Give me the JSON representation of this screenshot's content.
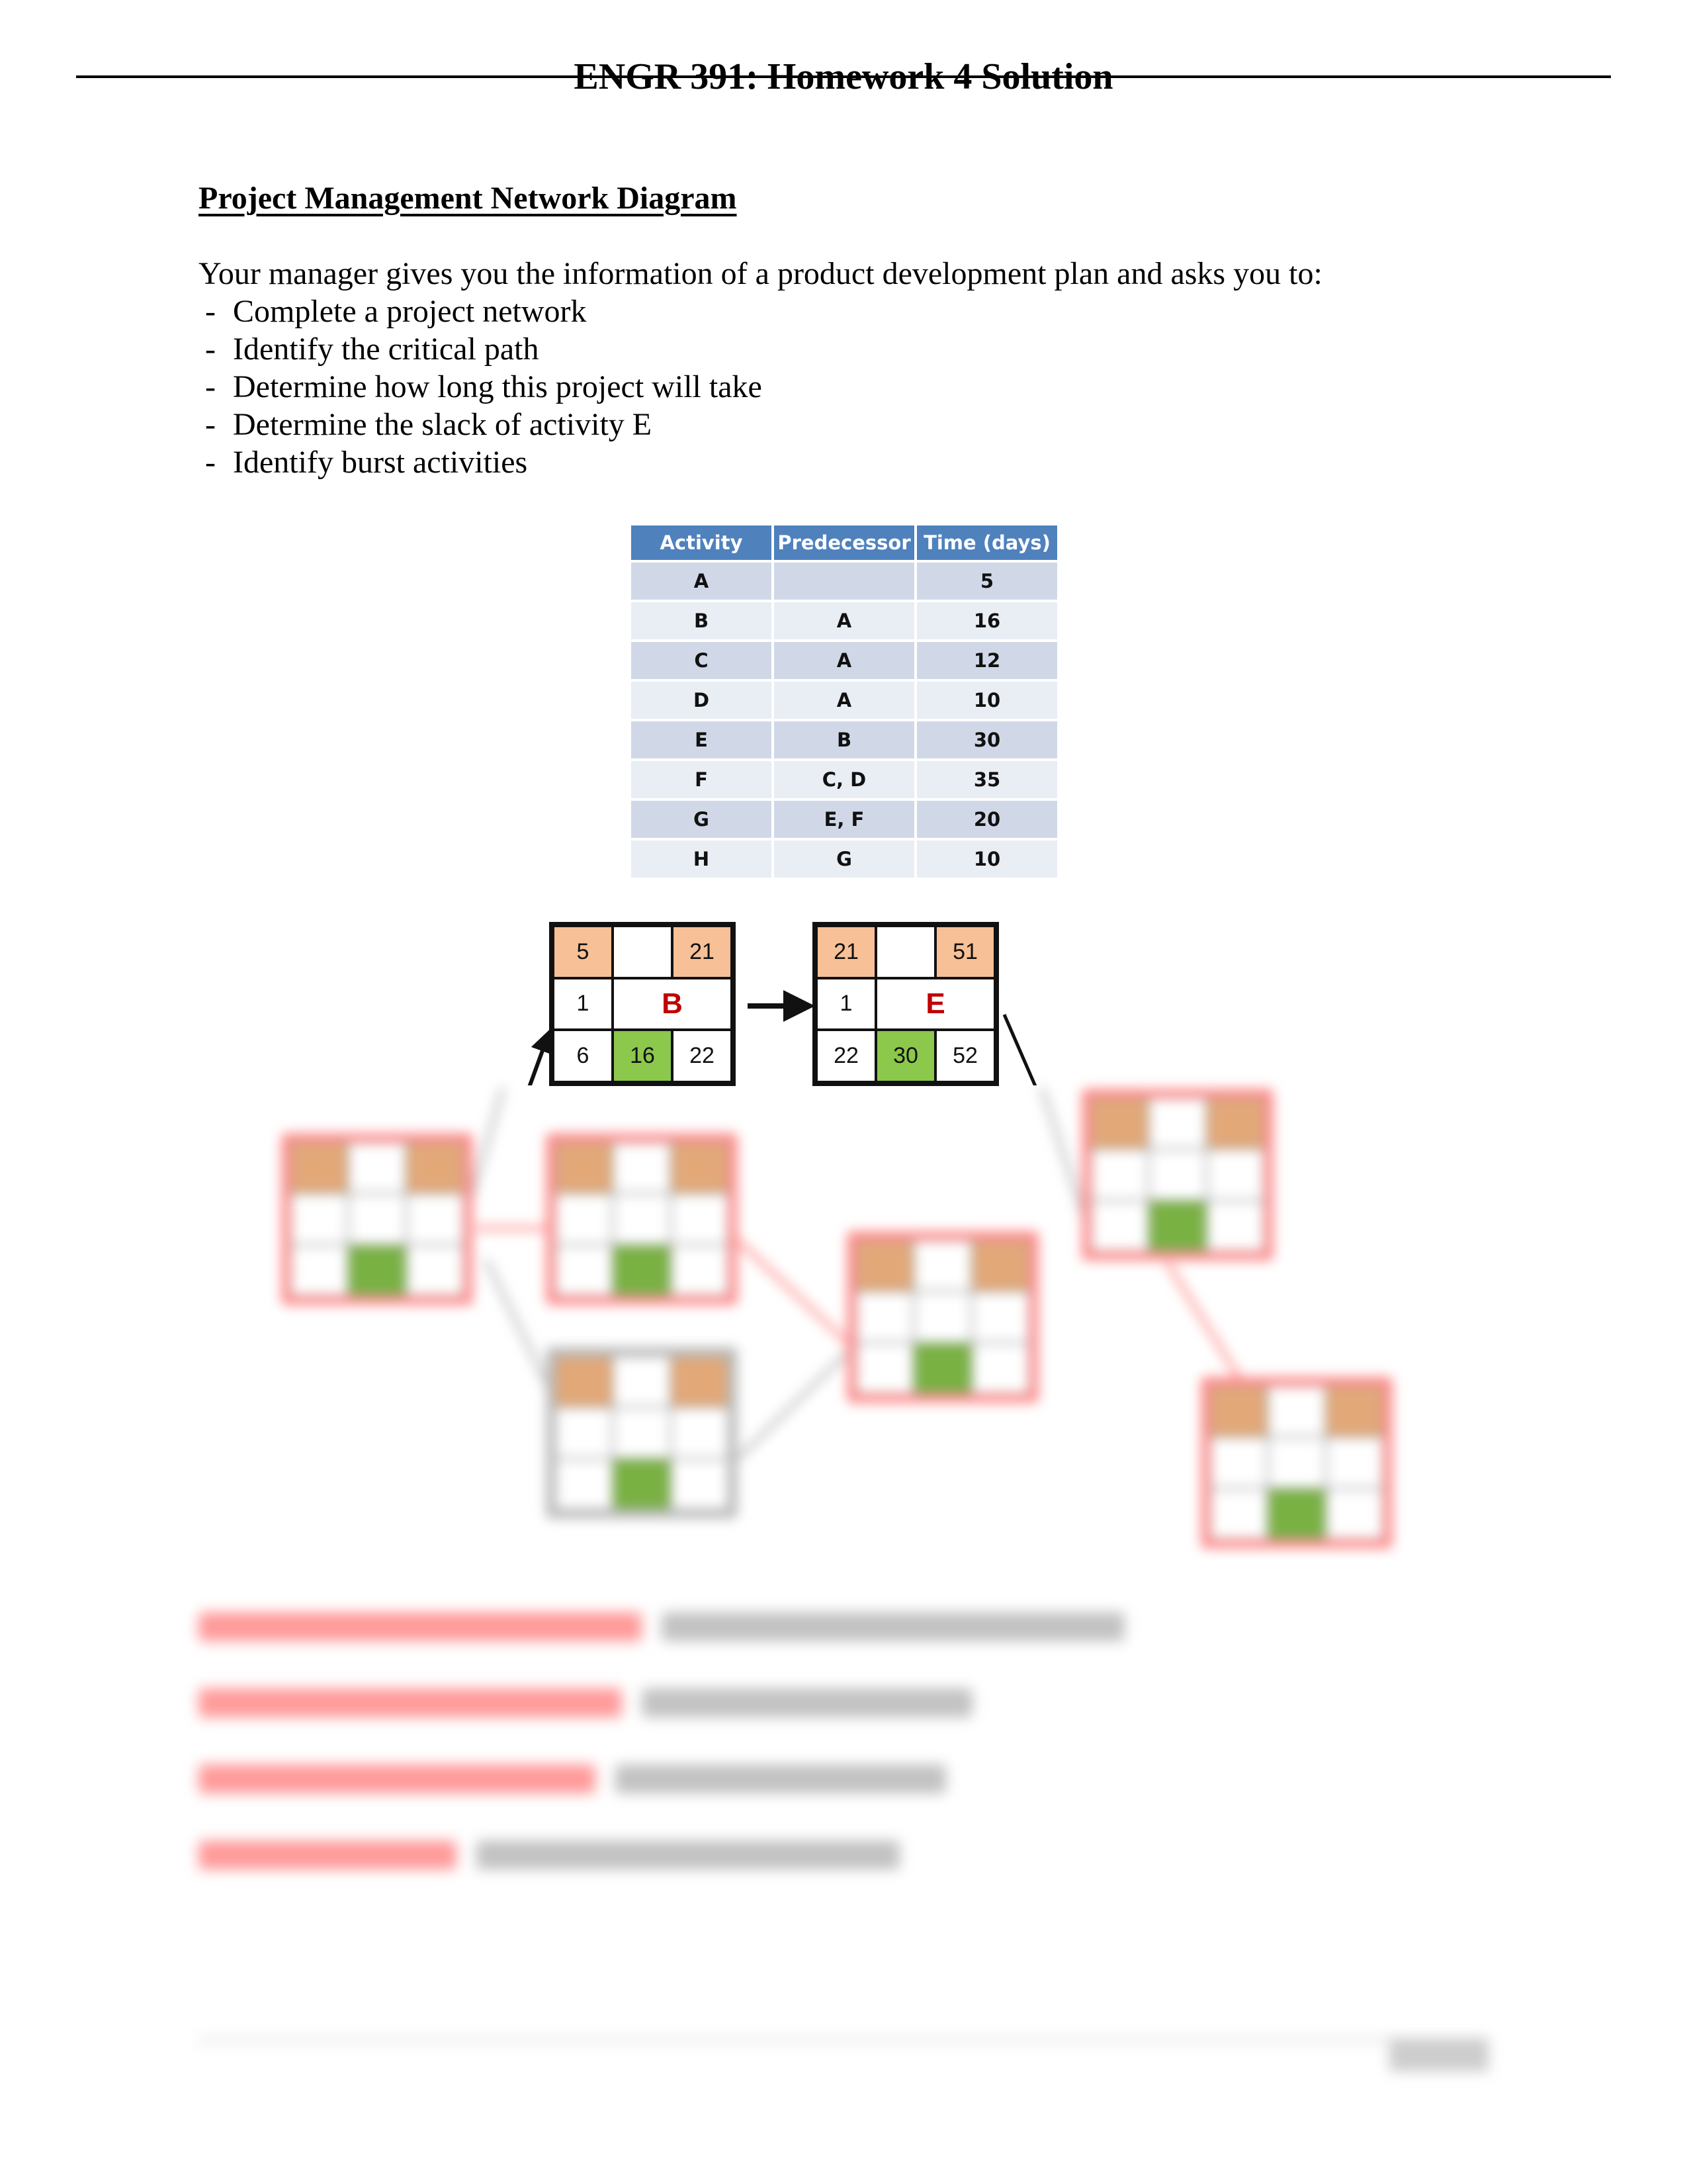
{
  "document": {
    "title": "ENGR 391: Homework 4 Solution",
    "section_heading": "Project Management Network Diagram",
    "intro": "Your manager gives you the information of a product development plan and asks you to:",
    "tasks": [
      "Complete a project network",
      "Identify the critical path",
      "Determine how long this project will take",
      "Determine the slack of activity E",
      "Identify burst activities"
    ],
    "task_bullet": "-"
  },
  "activity_table": {
    "headers": [
      "Activity",
      "Predecessor",
      "Time (days)"
    ],
    "rows": [
      {
        "activity": "A",
        "predecessor": "",
        "time": "5"
      },
      {
        "activity": "B",
        "predecessor": "A",
        "time": "16"
      },
      {
        "activity": "C",
        "predecessor": "A",
        "time": "12"
      },
      {
        "activity": "D",
        "predecessor": "A",
        "time": "10"
      },
      {
        "activity": "E",
        "predecessor": "B",
        "time": "30"
      },
      {
        "activity": "F",
        "predecessor": "C, D",
        "time": "35"
      },
      {
        "activity": "G",
        "predecessor": "E, F",
        "time": "20"
      },
      {
        "activity": "H",
        "predecessor": "G",
        "time": "10"
      }
    ],
    "colors": {
      "header": "#4f81bd",
      "row_odd": "#d0d8e8",
      "row_even": "#e9edf4"
    }
  },
  "network_nodes": [
    {
      "id": "B",
      "es": "5",
      "ef": "21",
      "slack": "1",
      "ls": "6",
      "duration": "16",
      "lf": "22"
    },
    {
      "id": "E",
      "es": "21",
      "ef": "51",
      "slack": "1",
      "ls": "22",
      "duration": "30",
      "lf": "52"
    }
  ],
  "node_colors": {
    "start_finish": "#f8c096",
    "duration": "#8cc84b",
    "activity_label": "#c00000",
    "critical_outline": "#ff8d8d"
  },
  "hidden_content_note": "Remaining network nodes and answers are blurred in the screenshot"
}
